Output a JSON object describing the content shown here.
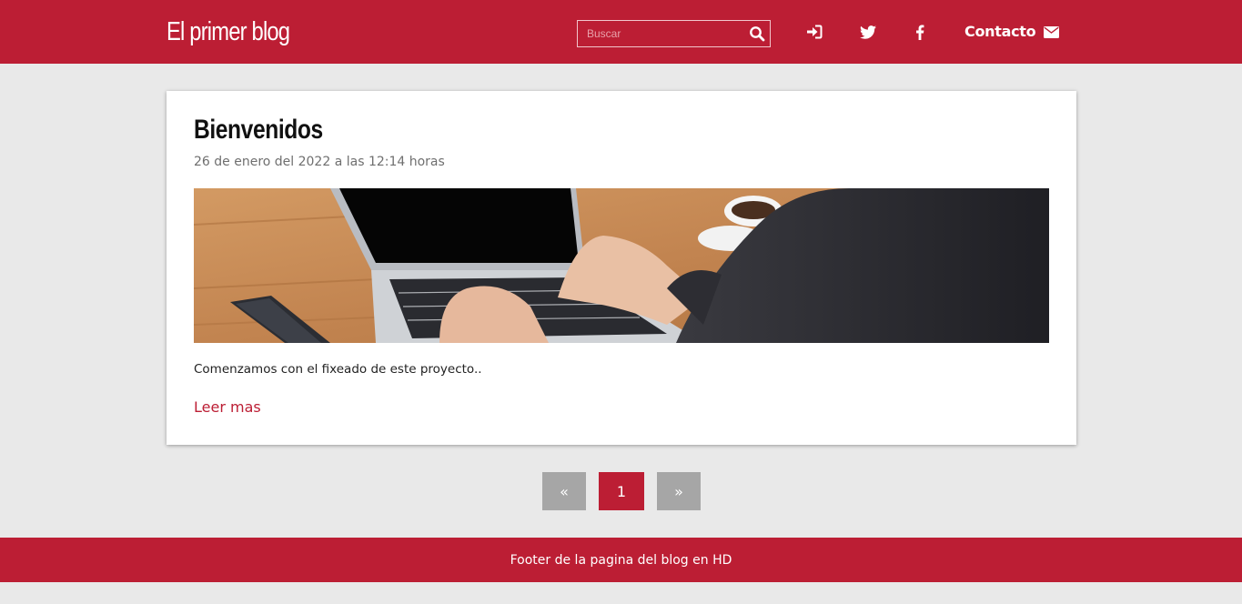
{
  "header": {
    "brand": "El primer blog",
    "search_placeholder": "Buscar",
    "nav_icons": [
      "sign-in-icon",
      "twitter-icon",
      "facebook-icon"
    ],
    "contact_label": "Contacto",
    "contact_icon": "envelope-icon"
  },
  "post": {
    "title": "Bienvenidos",
    "date": "26 de enero del 2022 a las 12:14 horas",
    "image": "laptop-typing-photo",
    "excerpt": "Comenzamos con el fixeado de este proyecto..",
    "read_more": "Leer mas"
  },
  "pagination": {
    "prev": "«",
    "current": "1",
    "next": "»"
  },
  "footer": {
    "text": "Footer de la pagina del blog en HD"
  },
  "colors": {
    "brand": "#bc1e34",
    "background": "#e9e9e9",
    "pagination_inactive": "#a6a6a6"
  }
}
